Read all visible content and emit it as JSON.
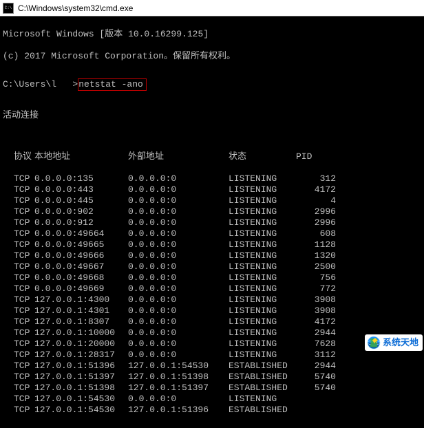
{
  "window": {
    "title": "C:\\Windows\\system32\\cmd.exe"
  },
  "banner": {
    "line1": "Microsoft Windows [版本 10.0.16299.125]",
    "line2": "(c) 2017 Microsoft Corporation。保留所有权利。"
  },
  "prompt": {
    "path": "C:\\Users\\l   >",
    "command": "netstat -ano"
  },
  "section_title": "活动连接",
  "headers": {
    "proto": "协议",
    "local": "本地地址",
    "foreign": "外部地址",
    "state": "状态",
    "pid": "PID"
  },
  "rows": [
    {
      "proto": "TCP",
      "local": "0.0.0.0:135",
      "foreign": "0.0.0.0:0",
      "state": "LISTENING",
      "pid": "312"
    },
    {
      "proto": "TCP",
      "local": "0.0.0.0:443",
      "foreign": "0.0.0.0:0",
      "state": "LISTENING",
      "pid": "4172"
    },
    {
      "proto": "TCP",
      "local": "0.0.0.0:445",
      "foreign": "0.0.0.0:0",
      "state": "LISTENING",
      "pid": "4"
    },
    {
      "proto": "TCP",
      "local": "0.0.0.0:902",
      "foreign": "0.0.0.0:0",
      "state": "LISTENING",
      "pid": "2996"
    },
    {
      "proto": "TCP",
      "local": "0.0.0.0:912",
      "foreign": "0.0.0.0:0",
      "state": "LISTENING",
      "pid": "2996"
    },
    {
      "proto": "TCP",
      "local": "0.0.0.0:49664",
      "foreign": "0.0.0.0:0",
      "state": "LISTENING",
      "pid": "608"
    },
    {
      "proto": "TCP",
      "local": "0.0.0.0:49665",
      "foreign": "0.0.0.0:0",
      "state": "LISTENING",
      "pid": "1128"
    },
    {
      "proto": "TCP",
      "local": "0.0.0.0:49666",
      "foreign": "0.0.0.0:0",
      "state": "LISTENING",
      "pid": "1320"
    },
    {
      "proto": "TCP",
      "local": "0.0.0.0:49667",
      "foreign": "0.0.0.0:0",
      "state": "LISTENING",
      "pid": "2500"
    },
    {
      "proto": "TCP",
      "local": "0.0.0.0:49668",
      "foreign": "0.0.0.0:0",
      "state": "LISTENING",
      "pid": "756"
    },
    {
      "proto": "TCP",
      "local": "0.0.0.0:49669",
      "foreign": "0.0.0.0:0",
      "state": "LISTENING",
      "pid": "772"
    },
    {
      "proto": "TCP",
      "local": "127.0.0.1:4300",
      "foreign": "0.0.0.0:0",
      "state": "LISTENING",
      "pid": "3908"
    },
    {
      "proto": "TCP",
      "local": "127.0.0.1:4301",
      "foreign": "0.0.0.0:0",
      "state": "LISTENING",
      "pid": "3908"
    },
    {
      "proto": "TCP",
      "local": "127.0.0.1:8307",
      "foreign": "0.0.0.0:0",
      "state": "LISTENING",
      "pid": "4172"
    },
    {
      "proto": "TCP",
      "local": "127.0.0.1:10000",
      "foreign": "0.0.0.0:0",
      "state": "LISTENING",
      "pid": "2944"
    },
    {
      "proto": "TCP",
      "local": "127.0.0.1:20000",
      "foreign": "0.0.0.0:0",
      "state": "LISTENING",
      "pid": "7628"
    },
    {
      "proto": "TCP",
      "local": "127.0.0.1:28317",
      "foreign": "0.0.0.0:0",
      "state": "LISTENING",
      "pid": "3112"
    },
    {
      "proto": "TCP",
      "local": "127.0.0.1:51396",
      "foreign": "127.0.0.1:54530",
      "state": "ESTABLISHED",
      "pid": "2944"
    },
    {
      "proto": "TCP",
      "local": "127.0.0.1:51397",
      "foreign": "127.0.0.1:51398",
      "state": "ESTABLISHED",
      "pid": "5740"
    },
    {
      "proto": "TCP",
      "local": "127.0.0.1:51398",
      "foreign": "127.0.0.1:51397",
      "state": "ESTABLISHED",
      "pid": "5740"
    },
    {
      "proto": "TCP",
      "local": "127.0.0.1:54530",
      "foreign": "0.0.0.0:0",
      "state": "LISTENING",
      "pid": ""
    },
    {
      "proto": "TCP",
      "local": "127.0.0.1:54530",
      "foreign": "127.0.0.1:51396",
      "state": "ESTABLISHED",
      "pid": ""
    }
  ],
  "watermark": {
    "text": "系统天地"
  }
}
